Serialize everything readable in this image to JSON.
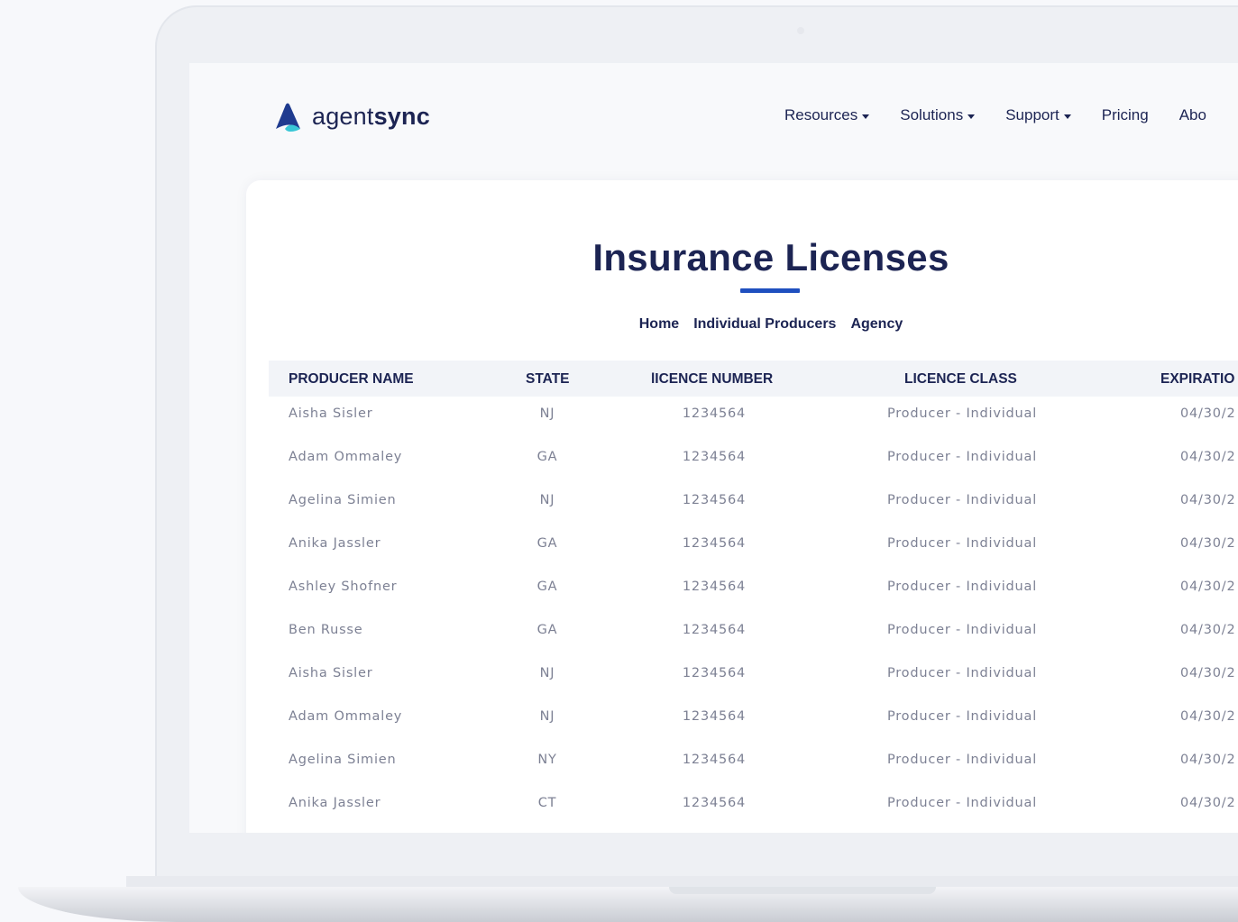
{
  "brand": {
    "name_light": "agent",
    "name_bold": "sync",
    "colors": {
      "navy": "#1c2453",
      "blue": "#1f4fbf",
      "teal": "#39c7d6"
    }
  },
  "nav": {
    "items": [
      {
        "label": "Resources",
        "dropdown": true
      },
      {
        "label": "Solutions",
        "dropdown": true
      },
      {
        "label": "Support",
        "dropdown": true
      },
      {
        "label": "Pricing",
        "dropdown": false
      },
      {
        "label": "Abo",
        "dropdown": false
      }
    ]
  },
  "page": {
    "title": "Insurance Licenses",
    "subnav": [
      "Home",
      "Individual Producers",
      "Agency"
    ]
  },
  "table": {
    "headers": [
      "PRODUCER NAME",
      "STATE",
      "lICENCE NUMBER",
      "LICENCE CLASS",
      "EXPIRATIO"
    ],
    "rows": [
      [
        "Aisha Sisler",
        "NJ",
        "1234564",
        "Producer - Individual",
        "04/30/2"
      ],
      [
        "Adam Ommaley",
        "GA",
        "1234564",
        "Producer - Individual",
        "04/30/2"
      ],
      [
        "Agelina Simien",
        "NJ",
        "1234564",
        "Producer - Individual",
        "04/30/2"
      ],
      [
        "Anika Jassler",
        "GA",
        "1234564",
        "Producer - Individual",
        "04/30/2"
      ],
      [
        "Ashley Shofner",
        "GA",
        "1234564",
        "Producer - Individual",
        "04/30/2"
      ],
      [
        "Ben Russe",
        "GA",
        "1234564",
        "Producer - Individual",
        "04/30/2"
      ],
      [
        "Aisha Sisler",
        "NJ",
        "1234564",
        "Producer - Individual",
        "04/30/2"
      ],
      [
        "Adam Ommaley",
        "NJ",
        "1234564",
        "Producer - Individual",
        "04/30/2"
      ],
      [
        "Agelina Simien",
        "NY",
        "1234564",
        "Producer - Individual",
        "04/30/2"
      ],
      [
        "Anika Jassler",
        "CT",
        "1234564",
        "Producer - Individual",
        "04/30/2"
      ]
    ]
  }
}
